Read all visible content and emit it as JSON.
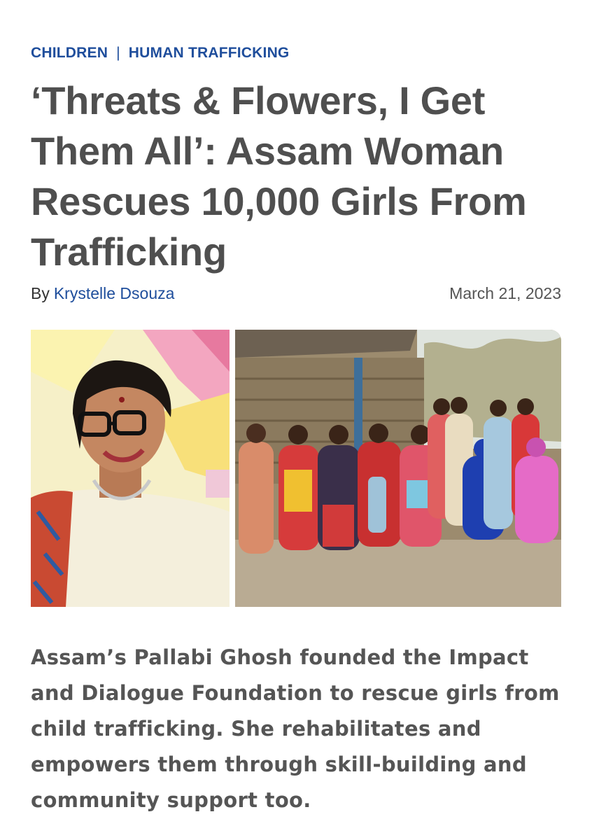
{
  "categories": [
    "CHILDREN",
    "HUMAN TRAFFICKING"
  ],
  "category_separator": "|",
  "headline": "‘Threats & Flowers, I Get Them All’: Assam Woman Rescues 10,000 Girls From Trafficking",
  "byline": {
    "by_label": "By",
    "author": "Krystelle Dsouza",
    "date": "March 21, 2023"
  },
  "summary": "Assam’s Pallabi Ghosh founded the Impact and Dialogue Foundation to rescue girls from child trafficking. She rehabilitates and empowers them through skill-building and community support too.",
  "images": {
    "left": "portrait-photo",
    "right": "group-photo"
  },
  "colors": {
    "category": "#1f4e9c",
    "author": "#1f4e9c",
    "headline": "#4f4f4f",
    "body": "#555555"
  }
}
